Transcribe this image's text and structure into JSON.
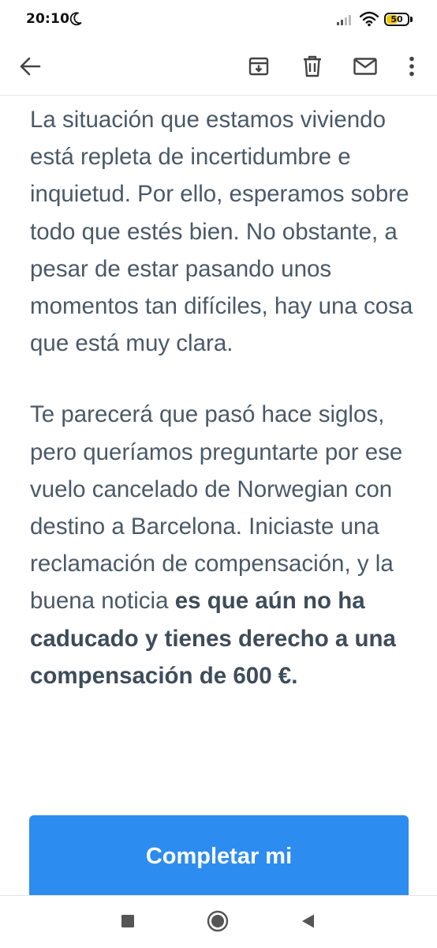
{
  "status_bar": {
    "time": "20:10",
    "battery_level": "50",
    "icons": [
      "moon-icon",
      "signal-icon",
      "wifi-icon",
      "battery-icon"
    ]
  },
  "toolbar": {
    "icons": [
      "back-arrow-icon",
      "archive-icon",
      "trash-icon",
      "mail-icon",
      "more-vert-icon"
    ]
  },
  "email": {
    "paragraph1": "La situación que estamos viviendo está repleta de incertidumbre e inquietud. Por ello, esperamos sobre todo que estés bien. No obstante, a pesar de estar pasando unos momentos tan difíciles, hay una cosa que está muy clara.",
    "paragraph2_plain": "Te parecerá que pasó hace siglos, pero queríamos preguntarte por ese vuelo cancelado de Norwegian con destino a Barcelona. Iniciaste una reclamación de compensación, y la buena noticia ",
    "paragraph2_bold": "es que aún no ha caducado y tienes derecho a una compensación de 600 €.",
    "cta_label": "Completar mi"
  },
  "nav_bar": {
    "icons": [
      "recents-square-icon",
      "home-circle-icon",
      "back-triangle-icon"
    ]
  },
  "colors": {
    "text": "#4a5968",
    "cta_background": "#2d8cf0",
    "battery_fill": "#f3c400"
  }
}
